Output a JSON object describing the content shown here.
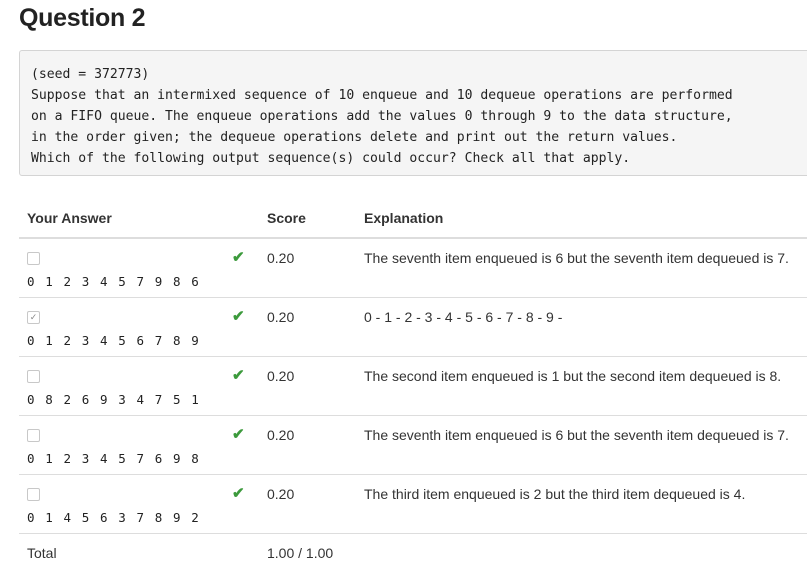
{
  "question": {
    "title": "Question 2",
    "lines": [
      "(seed = 372773)",
      "Suppose that an intermixed sequence of 10 enqueue and 10 dequeue operations are performed",
      "on a FIFO queue. The enqueue operations add the values 0 through 9 to the data structure,",
      "in the order given; the dequeue operations delete and print out the return values.",
      "Which of the following output sequence(s) could occur? Check all that apply."
    ]
  },
  "table": {
    "headers": {
      "answer": "Your Answer",
      "score": "Score",
      "explanation": "Explanation"
    },
    "rows": [
      {
        "checked": false,
        "sequence": "0 1 2 3 4 5 7 9 8 6",
        "score": "0.20",
        "explanation": "The seventh item enqueued is 6 but the seventh item dequeued is 7."
      },
      {
        "checked": true,
        "sequence": "0 1 2 3 4 5 6 7 8 9",
        "score": "0.20",
        "explanation": "0 - 1 - 2 - 3 - 4 - 5 - 6 - 7 - 8 - 9 -"
      },
      {
        "checked": false,
        "sequence": "0 8 2 6 9 3 4 7 5 1",
        "score": "0.20",
        "explanation": "The second item enqueued is 1 but the second item dequeued is 8."
      },
      {
        "checked": false,
        "sequence": "0 1 2 3 4 5 7 6 9 8",
        "score": "0.20",
        "explanation": "The seventh item enqueued is 6 but the seventh item dequeued is 7."
      },
      {
        "checked": false,
        "sequence": "0 1 4 5 6 3 7 8 9 2",
        "score": "0.20",
        "explanation": "The third item enqueued is 2 but the third item dequeued is 4."
      }
    ],
    "total": {
      "label": "Total",
      "score": "1.00 / 1.00"
    }
  },
  "icons": {
    "correct": "checkmark-icon",
    "checkmark_color": "#3c9a3c"
  }
}
